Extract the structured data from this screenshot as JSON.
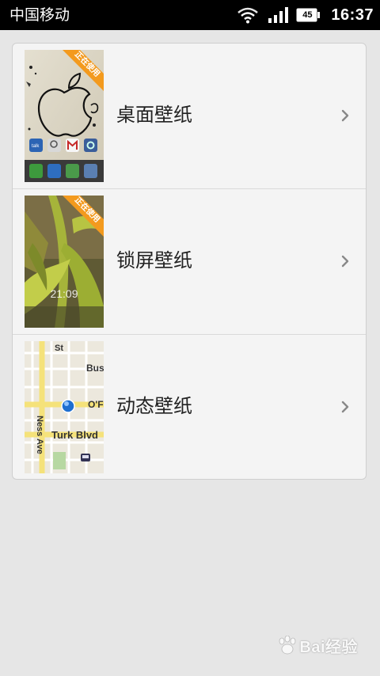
{
  "status_bar": {
    "carrier": "中国移动",
    "battery_level": "45",
    "time": "16:37",
    "icons": [
      "wifi-icon",
      "signal-icon",
      "battery-icon"
    ]
  },
  "wallpaper_menu": {
    "items": [
      {
        "label": "桌面壁纸",
        "thumbnail": "desktop-wallpaper-thumbnail",
        "ribbon": "正在使用"
      },
      {
        "label": "锁屏壁纸",
        "thumbnail": "lockscreen-wallpaper-thumbnail",
        "ribbon": "正在使用",
        "preview_clock": "21:09"
      },
      {
        "label": "动态壁纸",
        "thumbnail": "live-wallpaper-thumbnail",
        "map_labels": [
          "St",
          "Bus",
          "Ness Ave",
          "O'F",
          "Turk Blvd"
        ]
      }
    ],
    "chevron_icon": "chevron-right-icon"
  },
  "watermark": {
    "text": "Bai经验"
  },
  "colors": {
    "status_bar_bg": "#000000",
    "page_bg": "#e6e6e6",
    "card_bg": "#f4f4f4",
    "ribbon": "#f39a1e",
    "label_text": "#222222",
    "chevron": "#888888"
  }
}
